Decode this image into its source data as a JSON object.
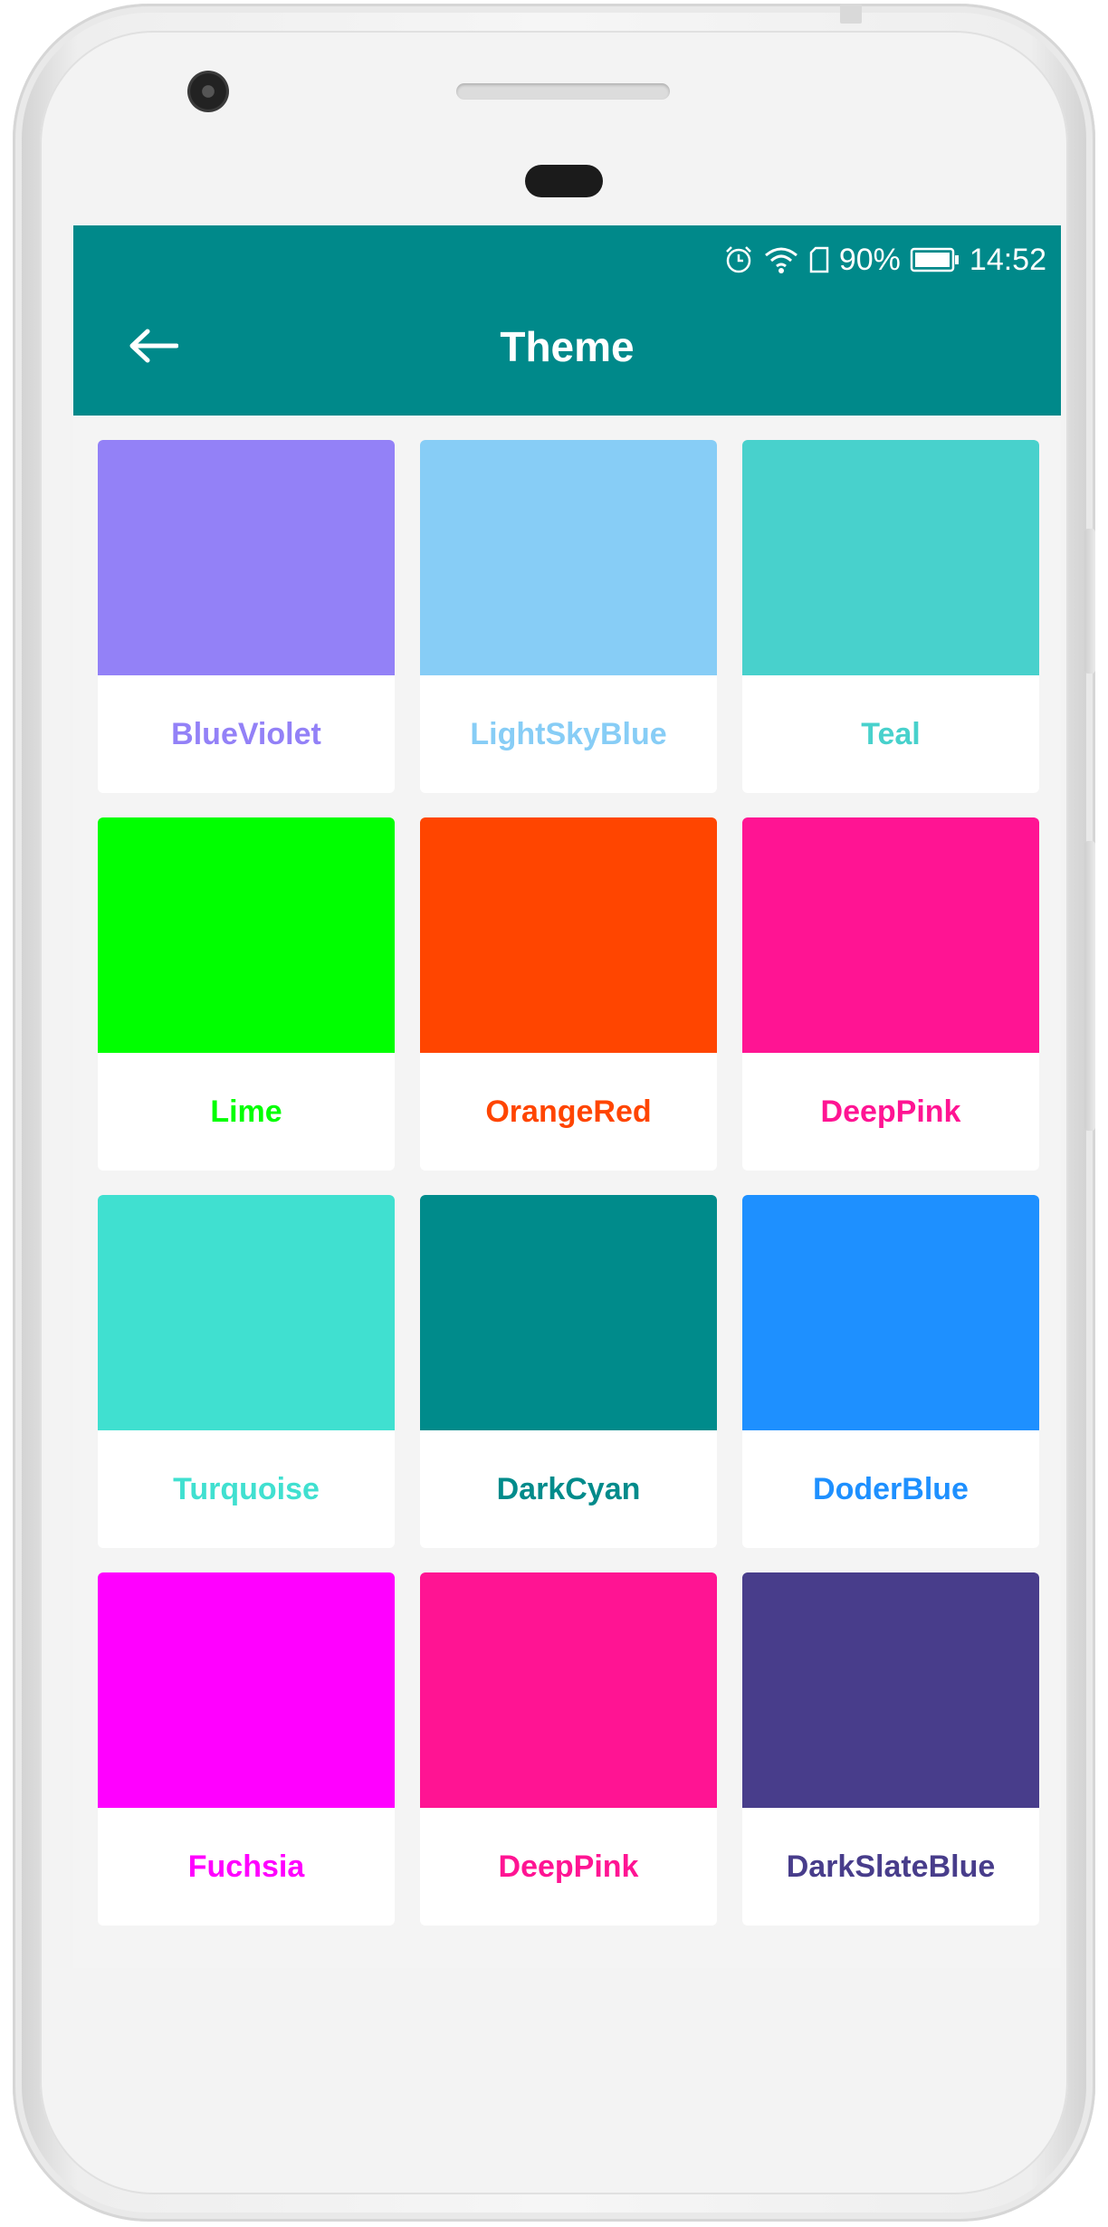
{
  "status_bar": {
    "battery_percent": "90%",
    "time": "14:52",
    "icons": [
      "alarm-icon",
      "wifi-icon",
      "sim-card-icon",
      "battery-icon"
    ]
  },
  "app_bar": {
    "title": "Theme",
    "background_color": "#00898a",
    "back_icon": "arrow-left-icon"
  },
  "themes": [
    {
      "name": "BlueViolet",
      "swatch_color": "#9381f7",
      "text_color": "#9381f7"
    },
    {
      "name": "LightSkyBlue",
      "swatch_color": "#87cdf6",
      "text_color": "#87cdf6"
    },
    {
      "name": "Teal",
      "swatch_color": "#48d1cc",
      "text_color": "#48d1cc"
    },
    {
      "name": "Lime",
      "swatch_color": "#00ff00",
      "text_color": "#00ff00"
    },
    {
      "name": "OrangeRed",
      "swatch_color": "#ff4500",
      "text_color": "#ff4500"
    },
    {
      "name": "DeepPink",
      "swatch_color": "#ff1493",
      "text_color": "#ff1493"
    },
    {
      "name": "Turquoise",
      "swatch_color": "#40e0d0",
      "text_color": "#40e0d0"
    },
    {
      "name": "DarkCyan",
      "swatch_color": "#008b8b",
      "text_color": "#008b8b"
    },
    {
      "name": "DoderBlue",
      "swatch_color": "#1e90ff",
      "text_color": "#1e90ff"
    },
    {
      "name": "Fuchsia",
      "swatch_color": "#ff00ff",
      "text_color": "#ff00ff"
    },
    {
      "name": "DeepPink",
      "swatch_color": "#ff1493",
      "text_color": "#ff1493"
    },
    {
      "name": "DarkSlateBlue",
      "swatch_color": "#483d8b",
      "text_color": "#483d8b"
    }
  ]
}
